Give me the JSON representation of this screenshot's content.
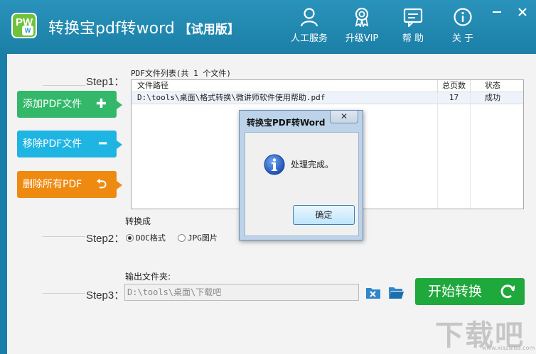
{
  "app": {
    "title": "转换宝pdf转word",
    "edition": "【试用版】",
    "logo_text": "PW",
    "logo_badge": "W"
  },
  "nav": [
    {
      "label": "人工服务",
      "icon": "person-icon"
    },
    {
      "label": "升级VIP",
      "icon": "vip-badge-icon"
    },
    {
      "label": "帮 助",
      "icon": "chat-icon"
    },
    {
      "label": "关 于",
      "icon": "info-icon"
    }
  ],
  "steps": {
    "step1": "Step1：",
    "step2": "Step2：",
    "step3": "Step3："
  },
  "buttons": {
    "add": "添加PDF文件",
    "remove": "移除PDF文件",
    "remove_all": "删除所有PDF",
    "start": "开始转换"
  },
  "file_list": {
    "caption": "PDF文件列表(共 1 个文件)",
    "columns": [
      "文件路径",
      "总页数",
      "状态"
    ],
    "rows": [
      {
        "path": "D:\\tools\\桌面\\格式转换\\微讲师软件使用帮助.pdf",
        "pages": "17",
        "status": "成功"
      }
    ]
  },
  "convert": {
    "label": "转换成",
    "options": [
      {
        "label": "DOC格式",
        "selected": true
      },
      {
        "label": "JPG图片",
        "selected": false
      }
    ]
  },
  "output": {
    "label": "输出文件夹:",
    "path": "D:\\tools\\桌面\\下载吧"
  },
  "dialog": {
    "title": "转换宝PDF转Word",
    "close": "✕",
    "message": "处理完成。",
    "ok": "确定"
  },
  "watermark": {
    "text": "下载吧",
    "url": "www.xiazaiba.com"
  },
  "colors": {
    "titlebar": "#1b7fa6",
    "add": "#33b86a",
    "remove": "#1fb5e2",
    "remove_all": "#ef8a11",
    "start": "#1fa83b"
  }
}
